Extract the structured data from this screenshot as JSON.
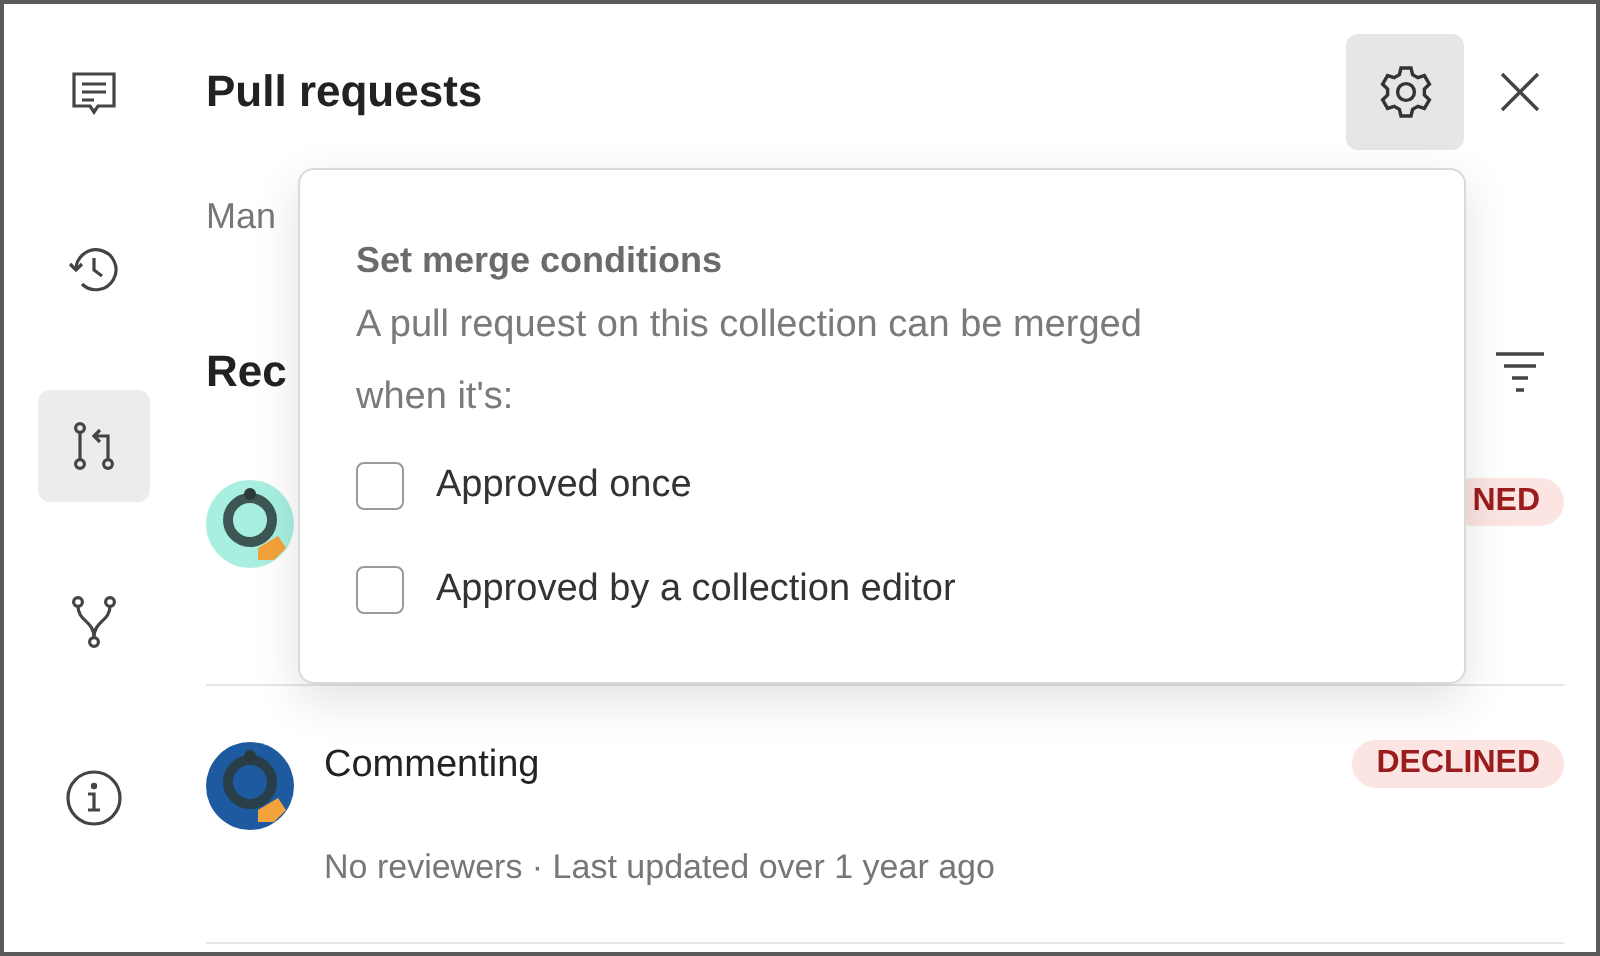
{
  "sidebar": {
    "items": [
      {
        "kind": "comments",
        "selected": false
      },
      {
        "kind": "history",
        "selected": false
      },
      {
        "kind": "pull-request",
        "selected": true
      },
      {
        "kind": "fork",
        "selected": false
      },
      {
        "kind": "info",
        "selected": false
      }
    ]
  },
  "header": {
    "title": "Pull requests",
    "settings_pressed": true
  },
  "description": "Man",
  "section_title": "Rec",
  "requests": [
    {
      "color": "#a8efe0",
      "status": "NED",
      "kind": "declined"
    },
    {
      "color": "#1d5aa0",
      "title": "Commenting",
      "status": "DECLINED",
      "kind": "declined",
      "meta": "No reviewers · Last updated over 1 year ago"
    }
  ],
  "popover": {
    "title": "Set merge conditions",
    "description": "A pull request on this collection can be merged when it's:",
    "options": [
      {
        "label": "Approved once",
        "checked": false
      },
      {
        "label": "Approved by a collection editor",
        "checked": false
      }
    ]
  }
}
